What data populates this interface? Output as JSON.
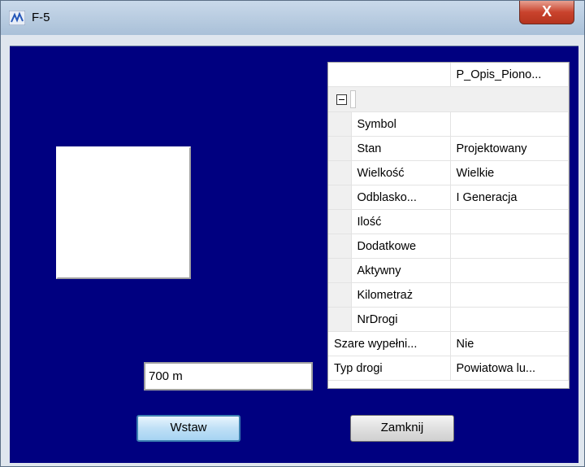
{
  "window": {
    "title": "F-5",
    "close_label": "X"
  },
  "preview": {},
  "distance": {
    "value": "700 m"
  },
  "buttons": {
    "insert_label": "Wstaw",
    "close_label": "Zamknij"
  },
  "grid": {
    "header": "P_Opis_Piono...",
    "properties": [
      {
        "name": "Symbol",
        "value": ""
      },
      {
        "name": "Stan",
        "value": "Projektowany"
      },
      {
        "name": "Wielkość",
        "value": "Wielkie"
      },
      {
        "name": "Odblasko...",
        "value": "I Generacja"
      },
      {
        "name": "Ilość",
        "value": ""
      },
      {
        "name": "Dodatkowe",
        "value": ""
      },
      {
        "name": "Aktywny",
        "value": ""
      },
      {
        "name": "Kilometraż",
        "value": ""
      },
      {
        "name": "NrDrogi",
        "value": ""
      }
    ],
    "extra": [
      {
        "name": "Szare wypełni...",
        "value": "Nie"
      },
      {
        "name": "Typ drogi",
        "value": "Powiatowa lu..."
      }
    ]
  }
}
